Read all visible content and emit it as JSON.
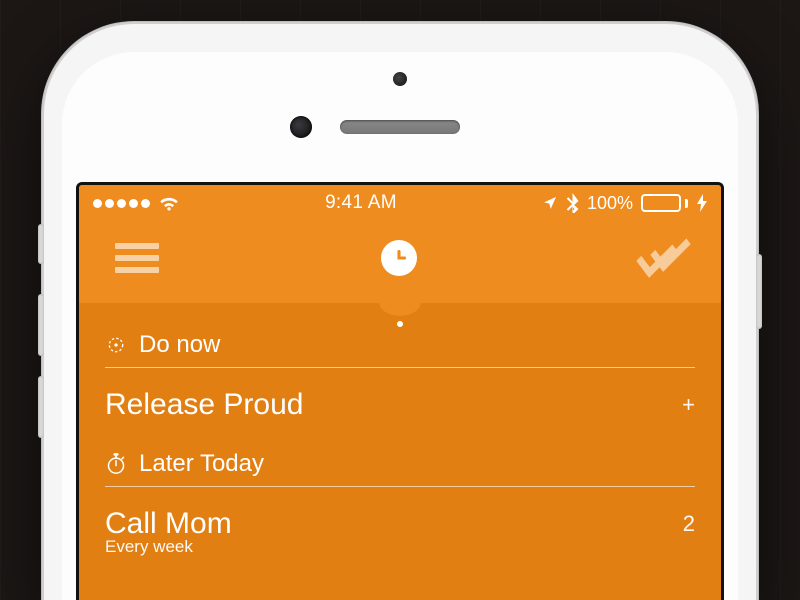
{
  "statusbar": {
    "signal_dots": 5,
    "time": "9:41 AM",
    "battery_percent": "100%"
  },
  "topnav": {
    "menu_name": "menu",
    "center_name": "clock",
    "right_name": "done-checks"
  },
  "sections": [
    {
      "icon": "target-icon",
      "label": "Do now",
      "tasks": [
        {
          "title": "Release Proud",
          "badge": "+",
          "subtitle": null
        }
      ]
    },
    {
      "icon": "stopwatch-icon",
      "label": "Later Today",
      "tasks": [
        {
          "title": "Call Mom",
          "badge": "2",
          "subtitle": "Every week"
        }
      ]
    }
  ]
}
